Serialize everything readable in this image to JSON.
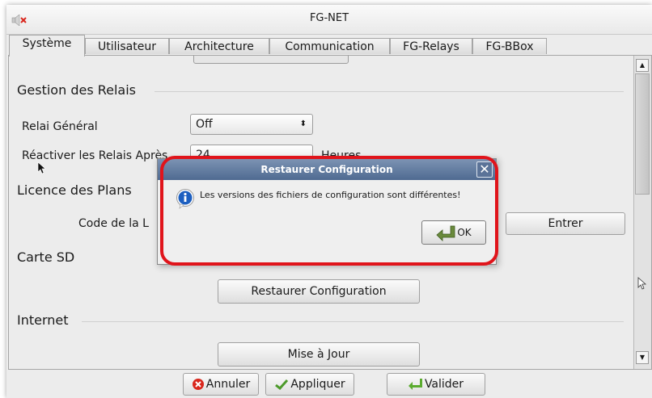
{
  "window": {
    "title": "FG-NET"
  },
  "tabs": [
    {
      "label": "Système",
      "active": true
    },
    {
      "label": "Utilisateur",
      "active": false
    },
    {
      "label": "Architecture",
      "active": false
    },
    {
      "label": "Communication",
      "active": false
    },
    {
      "label": "FG-Relays",
      "active": false
    },
    {
      "label": "FG-BBox",
      "active": false
    }
  ],
  "relais": {
    "section_title": "Gestion des Relais",
    "general_label": "Relai Général",
    "general_value": "Off",
    "reactivate_label": "Réactiver les Relais Après",
    "reactivate_value": "24",
    "reactivate_unit": "Heures"
  },
  "licence": {
    "section_title": "Licence des Plans",
    "code_label": "Code de la L",
    "enter_button": "Entrer"
  },
  "sd": {
    "section_title": "Carte SD",
    "restore_button": "Restaurer Configuration"
  },
  "internet": {
    "section_title": "Internet",
    "update_button": "Mise à Jour"
  },
  "footer": {
    "cancel_label": "Annuler",
    "apply_label": "Appliquer",
    "validate_label": "Valider"
  },
  "dialog": {
    "title": "Restaurer Configuration",
    "message": "Les versions des fichiers de configuration sont différentes!",
    "ok_label": "OK",
    "close_glyph": "✕"
  },
  "colors": {
    "highlight": "#e0141b",
    "dialog_title": "#5a7399",
    "cancel_icon": "#d9261c",
    "check_icon": "#4c9a2a",
    "info_icon": "#1d5fc0"
  },
  "icons": [
    "mute-speaker-icon",
    "info-icon",
    "cancel-icon",
    "check-icon",
    "validate-arrow-icon",
    "ok-arrow-icon",
    "mouse-cursor-icon"
  ]
}
